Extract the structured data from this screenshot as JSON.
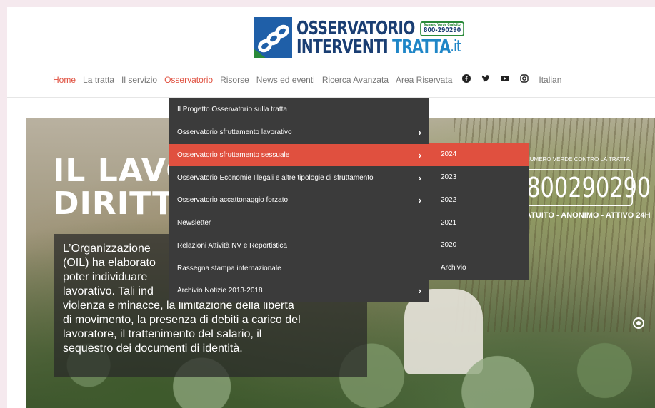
{
  "logo": {
    "line1": "OSSERVATORIO",
    "line2": "INTERVENTI",
    "line2_accent": "TRATTA",
    "suffix": ".it",
    "badge_small": "Numero Verde Gratuito",
    "badge_number": "800-290290"
  },
  "nav": {
    "items": [
      {
        "label": "Home",
        "active": true
      },
      {
        "label": "La tratta",
        "active": false
      },
      {
        "label": "Il servizio",
        "active": false
      },
      {
        "label": "Osservatorio",
        "active": true
      },
      {
        "label": "Risorse",
        "active": false
      },
      {
        "label": "News ed eventi",
        "active": false
      },
      {
        "label": "Ricerca Avanzata",
        "active": false
      },
      {
        "label": "Area Riservata",
        "active": false
      }
    ],
    "social": [
      "facebook-icon",
      "twitter-icon",
      "youtube-icon",
      "instagram-icon"
    ],
    "language": "Italian"
  },
  "dropdown": {
    "items": [
      {
        "label": "Il Progetto Osservatorio sulla tratta",
        "has_submenu": false
      },
      {
        "label": "Osservatorio sfruttamento lavorativo",
        "has_submenu": true
      },
      {
        "label": "Osservatorio sfruttamento sessuale",
        "has_submenu": true,
        "highlight": true
      },
      {
        "label": "Osservatorio Economie Illegali e altre tipologie di sfruttamento",
        "has_submenu": true
      },
      {
        "label": "Osservatorio accattonaggio forzato",
        "has_submenu": true
      },
      {
        "label": "Newsletter",
        "has_submenu": false
      },
      {
        "label": "Relazioni Attività NV e Reportistica",
        "has_submenu": false
      },
      {
        "label": "Rassegna stampa internazionale",
        "has_submenu": false
      },
      {
        "label": "Archivio Notizie 2013-2018",
        "has_submenu": true
      }
    ],
    "chevron": "›"
  },
  "submenu": {
    "items": [
      "2024",
      "2023",
      "2022",
      "2021",
      "2020",
      "Archivio"
    ],
    "highlight_index": 0
  },
  "hero": {
    "title_line1": "IL LAVO",
    "title_line2": "DIRITTI",
    "text": "L’Organizzazione (OIL) ha elaborato poter individuare lavorativo. Tali ind violenza e minacce, la limitazione della libertà di movimento, la presenza di debiti a carico del lavoratore, il trattenimento del salario, il sequestro dei documenti di identità.",
    "text_lines": [
      "L’Organizzazione",
      "(OIL) ha elaborato",
      "poter individuare",
      "lavorativo. Tali ind",
      "violenza e minacce, la limitazione della libertà",
      "di movimento, la presenza di debiti a carico del",
      "lavoratore, il trattenimento del salario, il",
      "sequestro dei documenti di identità."
    ],
    "hotline_label": "NUMERO VERDE CONTRO LA TRATTA",
    "hotline_number": "800290290",
    "hotline_sub": "ATUITO - ANONIMO - ATTIVO 24H"
  },
  "colors": {
    "accent": "#e0503f",
    "menu_bg": "#3b3b3b",
    "logo_blue": "#1a3e73",
    "logo_light_blue": "#1f86c7"
  }
}
